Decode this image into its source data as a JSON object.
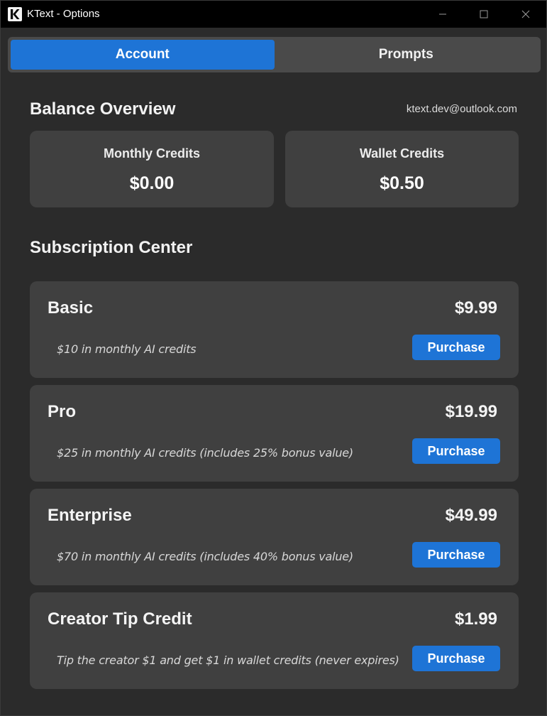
{
  "window": {
    "title": "KText - Options",
    "app_icon_letter": "K"
  },
  "tabs": [
    {
      "label": "Account",
      "active": true
    },
    {
      "label": "Prompts",
      "active": false
    }
  ],
  "balance": {
    "title": "Balance Overview",
    "email": "ktext.dev@outlook.com",
    "monthly": {
      "label": "Monthly Credits",
      "value": "$0.00"
    },
    "wallet": {
      "label": "Wallet Credits",
      "value": "$0.50"
    }
  },
  "subscription": {
    "title": "Subscription Center",
    "plans": [
      {
        "name": "Basic",
        "price": "$9.99",
        "description": "$10 in monthly AI credits",
        "button": "Purchase"
      },
      {
        "name": "Pro",
        "price": "$19.99",
        "description": "$25 in monthly AI credits (includes 25% bonus value)",
        "button": "Purchase"
      },
      {
        "name": "Enterprise",
        "price": "$49.99",
        "description": "$70 in monthly AI credits (includes 40% bonus value)",
        "button": "Purchase"
      },
      {
        "name": "Creator Tip Credit",
        "price": "$1.99",
        "description": "Tip the creator $1 and get $1 in wallet credits (never expires)",
        "button": "Purchase"
      }
    ]
  },
  "colors": {
    "accent": "#1e74d6",
    "background": "#2b2b2b",
    "card": "#404040",
    "titlebar": "#000000"
  }
}
